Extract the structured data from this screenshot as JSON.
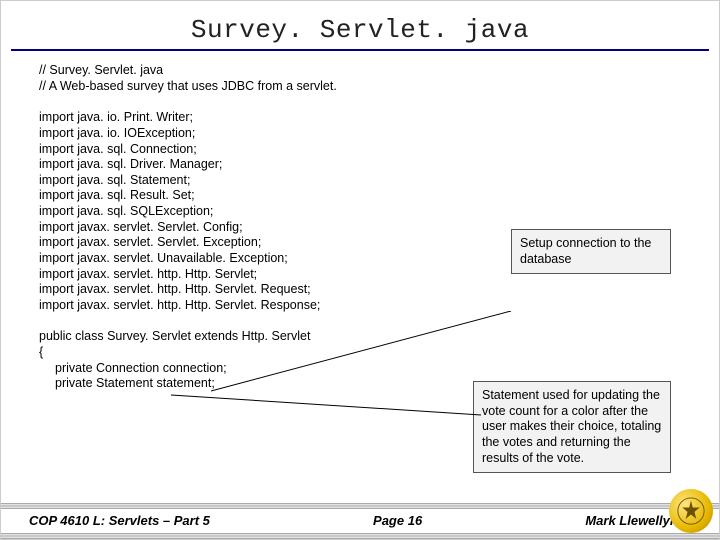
{
  "title": "Survey. Servlet. java",
  "comment1": "// Survey. Servlet. java",
  "comment2": "// A Web-based survey that uses JDBC from a servlet.",
  "imports": [
    "import java. io. Print. Writer;",
    "import java. io. IOException;",
    "import java. sql. Connection;",
    "import java. sql. Driver. Manager;",
    "import java. sql. Statement;",
    "import java. sql. Result. Set;",
    "import java. sql. SQLException;",
    "import javax. servlet. Servlet. Config;",
    "import javax. servlet. Servlet. Exception;",
    "import javax. servlet. Unavailable. Exception;",
    "import javax. servlet. http. Http. Servlet;",
    "import javax. servlet. http. Http. Servlet. Request;",
    "import javax. servlet. http. Http. Servlet. Response;"
  ],
  "class_decl": "public class Survey. Servlet extends Http. Servlet",
  "brace": "{",
  "member1": "private Connection connection;",
  "member2": "private Statement statement;",
  "callout1": "Setup connection to the database",
  "callout2": "Statement used for updating the vote count for a color after the user makes their choice, totaling the votes and returning the results of the vote.",
  "footer": {
    "left": "COP 4610 L: Servlets – Part 5",
    "center": "Page 16",
    "right": "Mark Llewellyn ©"
  }
}
